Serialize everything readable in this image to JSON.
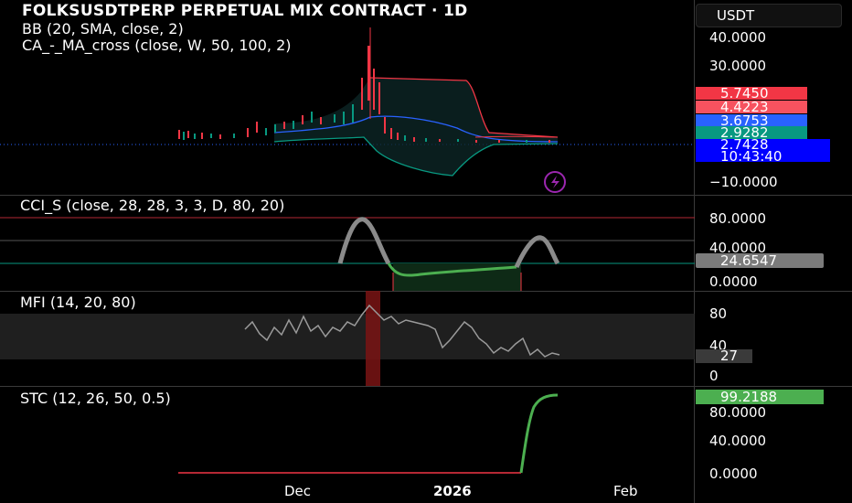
{
  "title": "FOLKSUSDTPERP PERPETUAL MIX CONTRACT · 1D",
  "indicators": {
    "bb": "BB (20, SMA, close, 2)",
    "ma_cross": "CA_-_MA_cross (close, W, 50, 100, 2)"
  },
  "currency": "USDT",
  "price_axis": [
    "40.0000",
    "30.0000",
    "−10.0000"
  ],
  "price_tags": [
    {
      "value": "5.7450",
      "color": "#f23645"
    },
    {
      "value": "4.4223",
      "color": "#f7525f"
    },
    {
      "value": "3.6753",
      "color": "#2962ff"
    },
    {
      "value": "2.9282",
      "color": "#089981"
    },
    {
      "value": "2.7428",
      "color": "#0000ff"
    }
  ],
  "countdown": "10:43:40",
  "cci": {
    "label": "CCI_S (close, 28, 28, 3, 3, D, 80, 20)",
    "axis": [
      "80.0000",
      "40.0000",
      "0.0000"
    ],
    "value": "24.6547"
  },
  "mfi": {
    "label": "MFI (14, 20, 80)",
    "axis": [
      "80",
      "40",
      "0"
    ],
    "value": "27"
  },
  "stc": {
    "label": "STC (12, 26, 50, 0.5)",
    "axis": [
      "80.0000",
      "40.0000",
      "0.0000"
    ],
    "value": "99.2188"
  },
  "time_axis": [
    "Dec",
    "2026",
    "Feb"
  ],
  "colors": {
    "up": "#089981",
    "down": "#f23645",
    "bb": "#2962ff",
    "green": "#4caf50"
  }
}
